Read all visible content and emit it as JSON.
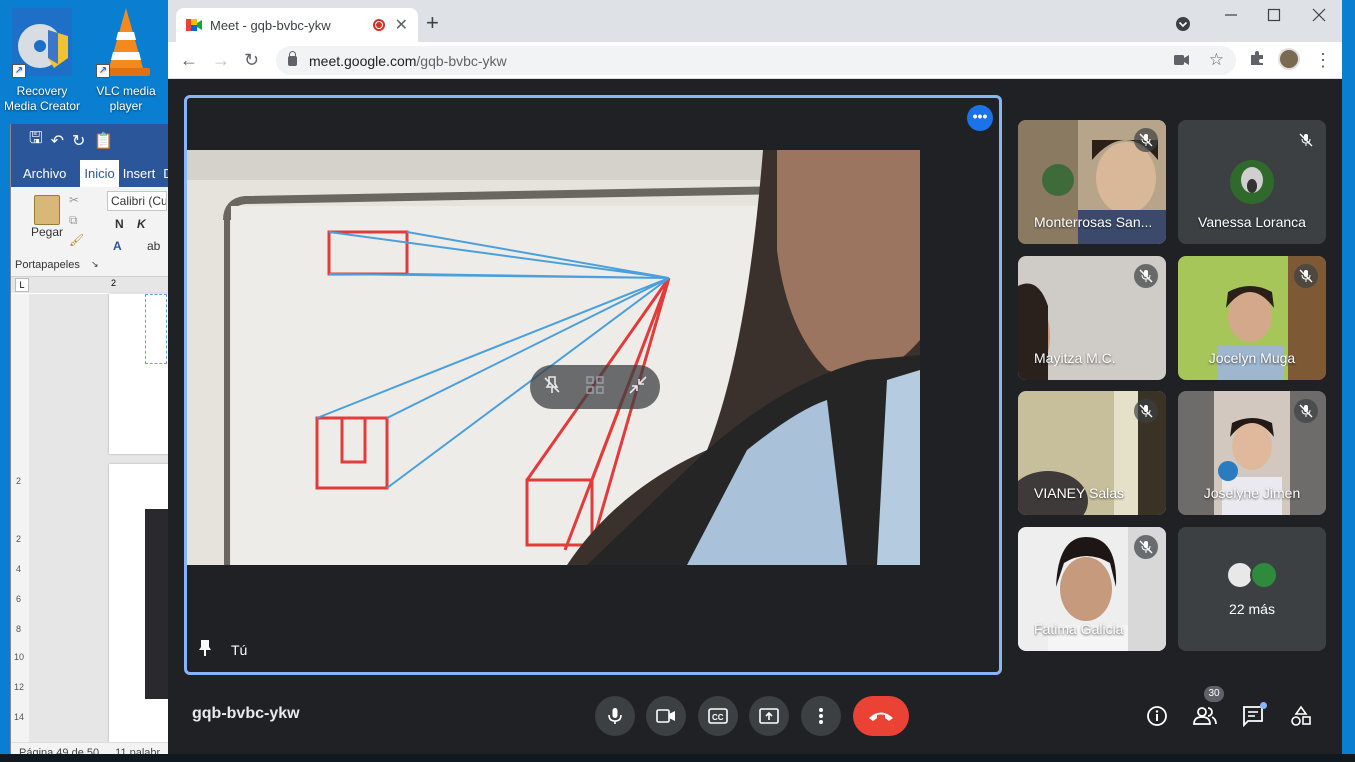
{
  "desktop": {
    "icons": [
      {
        "label": "Recovery Media Creator",
        "icon": "recovery-icon"
      },
      {
        "label": "VLC media player",
        "icon": "vlc-icon"
      }
    ]
  },
  "word": {
    "tabs": [
      "Archivo",
      "Inicio",
      "Insert",
      "D"
    ],
    "font_name": "Calibri (Cu",
    "paste_label": "Pegar",
    "clipboard_label": "Portapapeles",
    "bold": "N",
    "italic": "K",
    "ruler_number": "2",
    "vruler": [
      "2",
      "2",
      "4",
      "6",
      "8",
      "10",
      "12",
      "14"
    ],
    "status_page": "Página 49 de 50",
    "status_words": "11 palabr"
  },
  "browser": {
    "tab_title": "Meet - gqb-bvbc-ykw",
    "url_host": "meet.google.com",
    "url_path": "/gqb-bvbc-ykw",
    "close_glyph": "✕",
    "new_tab_glyph": "+"
  },
  "meet": {
    "meeting_code": "gqb-bvbc-ykw",
    "self_label": "Tú",
    "more_glyph": "•••",
    "participants": [
      {
        "name": "Monterrosas San...",
        "muted": true
      },
      {
        "name": "Vanessa Loranca",
        "muted": true
      },
      {
        "name": "Mayitza M.C.",
        "muted": true
      },
      {
        "name": "Jocelyn Muga",
        "muted": true
      },
      {
        "name": "VIANEY Salas",
        "muted": true
      },
      {
        "name": "Joselyne Jimen",
        "muted": true
      },
      {
        "name": "Fatima Galicia",
        "muted": true
      }
    ],
    "more_count": "22 más",
    "people_count": "30"
  }
}
